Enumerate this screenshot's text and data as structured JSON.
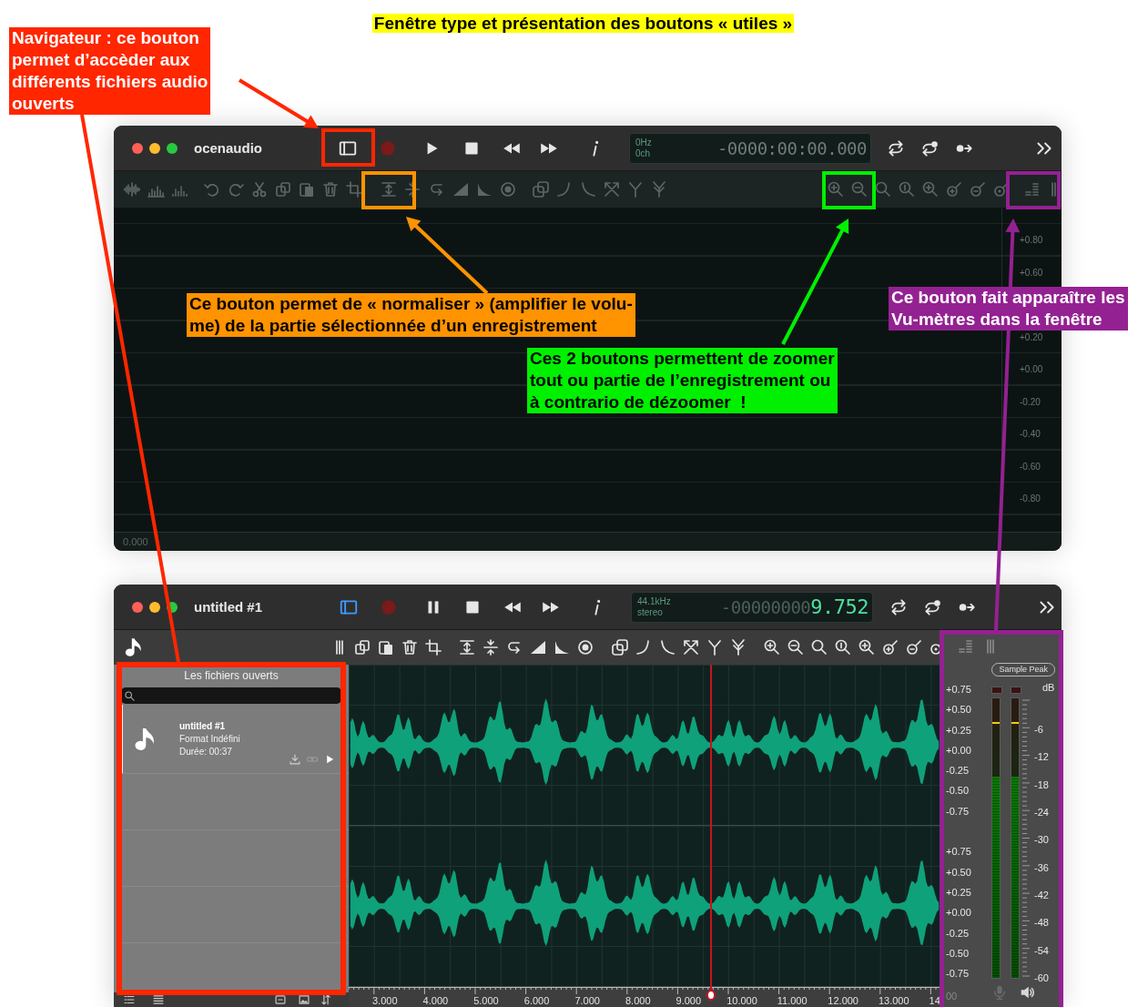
{
  "heading": "Fenêtre type et présentation des boutons « utiles »",
  "annotations": [
    {
      "kind": "navigator",
      "color": "#ff2600",
      "text": "Navigateur : ce bouton\npermet d’accèder aux\ndifférents fichiers audio\nouverts"
    },
    {
      "kind": "normalize",
      "color": "#ff9300",
      "text": "Ce bouton permet de « normaliser » (amplifier le volu-\nme) de la partie sélectionnée d’un enregistrement"
    },
    {
      "kind": "zoom",
      "color": "#00f000",
      "text": "Ces 2 boutons permettent de zoomer\ntout ou partie de l’enregistrement ou\nà contrario de dézoomer  !"
    },
    {
      "kind": "vu",
      "color": "#942192",
      "text": "Ce bouton fait apparaître les\nVu-mètres dans la fenêtre"
    }
  ],
  "empty_window": {
    "title": "ocenaudio",
    "navigator_on": false,
    "playing": false,
    "display": {
      "info_top": "0Hz",
      "info_bottom": "0ch",
      "time_dim": "-0000:00:00.000"
    },
    "scale_upper": [
      "+0.80",
      "+0.60"
    ],
    "scale_lower": [
      "+0.20",
      "+0.00",
      "-0.20",
      "-0.40",
      "-0.60",
      "-0.80"
    ],
    "ruler": [
      "0.000"
    ]
  },
  "file_window": {
    "title": "untitled #1",
    "navigator_on": true,
    "playing": true,
    "display": {
      "info_top": "44.1kHz",
      "info_bottom": "stereo",
      "time_dim": "-00000000",
      "time_lit": "9.752"
    },
    "sidebar": {
      "title": "Les fichiers ouverts",
      "files": [
        {
          "name": "untitled #1",
          "format": "Format Indéfini",
          "duration": "Durée: 00:37",
          "selected": true
        }
      ]
    },
    "ruler": [
      "3.000",
      "4.000",
      "5.000",
      "6.000",
      "7.000",
      "8.000",
      "9.000",
      "10.000",
      "11.000",
      "12.000",
      "13.000",
      "14"
    ],
    "vu": {
      "mode_button": "Sample Peak",
      "unit": "dB",
      "channel_scales": [
        [
          "+0.75",
          "+0.50",
          "+0.25",
          "+0.00",
          "-0.25",
          "-0.50",
          "-0.75"
        ],
        [
          "+0.75",
          "+0.50",
          "+0.25",
          "+0.00",
          "-0.25",
          "-0.50",
          "-0.75"
        ]
      ],
      "db_scale": [
        "-6",
        "-12",
        "-18",
        "-24",
        "-30",
        "-36",
        "-42",
        "-48",
        "-54",
        "-60"
      ],
      "meters": [
        {
          "level": 0.72,
          "peak": {
            "level": 0.91
          }
        },
        {
          "level": 0.72,
          "peak": {
            "level": 0.91
          }
        }
      ],
      "corner_text": "00"
    }
  }
}
